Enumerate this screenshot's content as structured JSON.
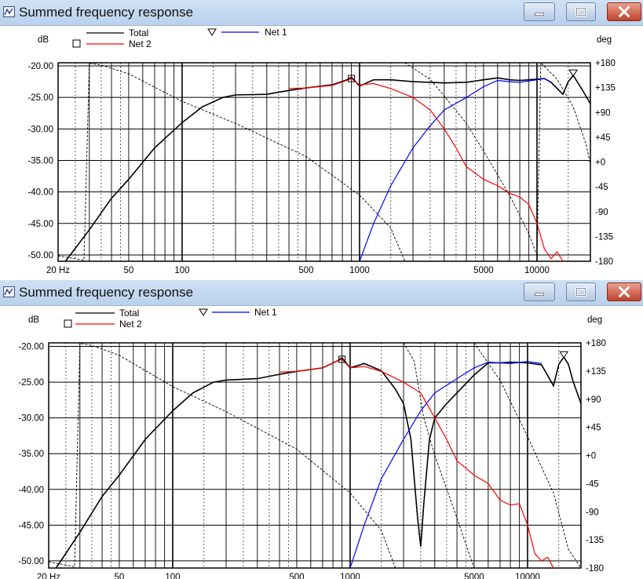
{
  "windows": [
    {
      "title": "Summed frequency response",
      "legend": {
        "total": "Total",
        "net1": "Net 1",
        "net2": "Net 2"
      },
      "units": {
        "left": "dB",
        "right": "deg"
      },
      "y_left_ticks": [
        "-20.00",
        "-25.00",
        "-30.00",
        "-35.00",
        "-40.00",
        "-45.00",
        "-50.00"
      ],
      "y_right_ticks": [
        "+180",
        "+135",
        "+90",
        "+45",
        "+0",
        "-45",
        "-90",
        "-135",
        "-180"
      ],
      "x_ticks": [
        "20 Hz",
        "50",
        "100",
        "500",
        "1000",
        "5000",
        "10000"
      ]
    },
    {
      "title": "Summed frequency response",
      "legend": {
        "total": "Total",
        "net1": "Net 1",
        "net2": "Net 2"
      },
      "units": {
        "left": "dB",
        "right": "deg"
      },
      "y_left_ticks": [
        "-20.00",
        "-25.00",
        "-30.00",
        "-35.00",
        "-40.00",
        "-45.00",
        "-50.00"
      ],
      "y_right_ticks": [
        "+180",
        "+135",
        "+90",
        "+45",
        "+0",
        "-45",
        "-90",
        "-135",
        "-180"
      ],
      "x_ticks": [
        "20 Hz",
        "50",
        "100",
        "500",
        "1000",
        "5000",
        "10000"
      ]
    }
  ],
  "colors": {
    "total": "#000000",
    "net1": "#0000ff",
    "net2": "#ff0000"
  },
  "icons": [
    "chart-app-icon",
    "minimize-icon",
    "maximize-icon",
    "close-icon",
    "triangle-marker-icon",
    "square-marker-icon"
  ],
  "chart_data": [
    {
      "type": "line",
      "x_scale": "log",
      "xlim": [
        20,
        20000
      ],
      "ylim": [
        -51,
        -19.5
      ],
      "y2lim": [
        -180,
        180
      ],
      "grid": true,
      "legend_position": "top",
      "series": [
        {
          "name": "Total",
          "axis": "left",
          "style": "solid",
          "points": [
            [
              22,
              -51
            ],
            [
              30,
              -46
            ],
            [
              40,
              -41
            ],
            [
              50,
              -38
            ],
            [
              70,
              -33
            ],
            [
              100,
              -29
            ],
            [
              130,
              -26.5
            ],
            [
              170,
              -25
            ],
            [
              200,
              -24.6
            ],
            [
              300,
              -24.5
            ],
            [
              400,
              -23.9
            ],
            [
              500,
              -23.5
            ],
            [
              700,
              -23.0
            ],
            [
              850,
              -22.2
            ],
            [
              900,
              -21.8
            ],
            [
              950,
              -22.5
            ],
            [
              1000,
              -23.2
            ],
            [
              1200,
              -22.2
            ],
            [
              1500,
              -22.2
            ],
            [
              2000,
              -22.5
            ],
            [
              3000,
              -22.7
            ],
            [
              4000,
              -22.6
            ],
            [
              5000,
              -22.2
            ],
            [
              6000,
              -21.9
            ],
            [
              7000,
              -22.2
            ],
            [
              8000,
              -22.3
            ],
            [
              10000,
              -22.1
            ],
            [
              11000,
              -22.0
            ],
            [
              12000,
              -22.6
            ],
            [
              14000,
              -24.5
            ],
            [
              15000,
              -22.5
            ],
            [
              16000,
              -21.5
            ],
            [
              18000,
              -23.8
            ],
            [
              20000,
              -26
            ]
          ]
        },
        {
          "name": "Net 1",
          "axis": "left",
          "style": "solid",
          "points": [
            [
              1000,
              -51
            ],
            [
              1200,
              -45
            ],
            [
              1500,
              -39
            ],
            [
              2000,
              -33
            ],
            [
              2500,
              -29.5
            ],
            [
              3000,
              -27
            ],
            [
              4000,
              -25
            ],
            [
              5000,
              -23.3
            ],
            [
              6000,
              -22.3
            ],
            [
              7000,
              -22.5
            ],
            [
              8000,
              -22.6
            ],
            [
              10000,
              -22.2
            ],
            [
              11000,
              -22.0
            ],
            [
              12000,
              -22.6
            ]
          ]
        },
        {
          "name": "Net 2",
          "axis": "left",
          "style": "solid",
          "points": [
            [
              400,
              -23.6
            ],
            [
              500,
              -23.5
            ],
            [
              700,
              -23.1
            ],
            [
              850,
              -22.3
            ],
            [
              900,
              -22.0
            ],
            [
              1000,
              -23.0
            ],
            [
              1200,
              -22.8
            ],
            [
              1500,
              -23.6
            ],
            [
              2000,
              -25
            ],
            [
              2500,
              -27
            ],
            [
              3000,
              -30
            ],
            [
              3500,
              -33
            ],
            [
              4000,
              -36
            ],
            [
              5000,
              -38
            ],
            [
              6000,
              -39
            ],
            [
              7000,
              -40.2
            ],
            [
              8000,
              -40.8
            ],
            [
              9000,
              -42
            ],
            [
              10000,
              -45
            ],
            [
              11000,
              -49
            ],
            [
              12000,
              -50.6
            ],
            [
              13000,
              -49.5
            ],
            [
              14000,
              -51
            ]
          ]
        },
        {
          "name": "",
          "axis": "right",
          "style": "dashed",
          "points": [
            [
              20,
              -170
            ],
            [
              28,
              -178
            ],
            [
              30,
              179
            ],
            [
              35,
              176
            ],
            [
              50,
              160
            ],
            [
              100,
              110
            ],
            [
              200,
              70
            ],
            [
              500,
              10
            ],
            [
              1000,
              -60
            ],
            [
              1500,
              -120
            ],
            [
              1800,
              -180
            ]
          ]
        },
        {
          "name": "",
          "axis": "right",
          "style": "dashed",
          "points": [
            [
              1800,
              180
            ],
            [
              2500,
              150
            ],
            [
              3000,
              120
            ],
            [
              4000,
              70
            ],
            [
              5000,
              20
            ],
            [
              7000,
              -60
            ],
            [
              9000,
              -130
            ],
            [
              10000,
              -170
            ],
            [
              10500,
              180
            ],
            [
              13000,
              150
            ],
            [
              16000,
              100
            ],
            [
              19000,
              30
            ],
            [
              20000,
              -5
            ]
          ]
        }
      ]
    },
    {
      "type": "line",
      "x_scale": "log",
      "xlim": [
        20,
        20000
      ],
      "ylim": [
        -51,
        -19.5
      ],
      "y2lim": [
        -180,
        180
      ],
      "grid": true,
      "legend_position": "top",
      "series": [
        {
          "name": "Total",
          "axis": "left",
          "style": "solid",
          "points": [
            [
              22,
              -51
            ],
            [
              30,
              -46
            ],
            [
              40,
              -41
            ],
            [
              50,
              -38
            ],
            [
              70,
              -33
            ],
            [
              100,
              -29
            ],
            [
              130,
              -26.5
            ],
            [
              170,
              -25
            ],
            [
              200,
              -24.7
            ],
            [
              300,
              -24.5
            ],
            [
              400,
              -23.9
            ],
            [
              500,
              -23.5
            ],
            [
              700,
              -23.0
            ],
            [
              850,
              -22.0
            ],
            [
              900,
              -21.6
            ],
            [
              1000,
              -23.0
            ],
            [
              1200,
              -22.4
            ],
            [
              1500,
              -23.4
            ],
            [
              1800,
              -26
            ],
            [
              2000,
              -28
            ],
            [
              2200,
              -33
            ],
            [
              2400,
              -44
            ],
            [
              2500,
              -48
            ],
            [
              2600,
              -42
            ],
            [
              2800,
              -33
            ],
            [
              3000,
              -30
            ],
            [
              3500,
              -28
            ],
            [
              4000,
              -26.5
            ],
            [
              5000,
              -24
            ],
            [
              6000,
              -22.3
            ],
            [
              7000,
              -22.3
            ],
            [
              8000,
              -22.2
            ],
            [
              10000,
              -22.3
            ],
            [
              12000,
              -22.6
            ],
            [
              14000,
              -25.5
            ],
            [
              15000,
              -22.5
            ],
            [
              16000,
              -21.5
            ],
            [
              17000,
              -22.5
            ],
            [
              18000,
              -24.8
            ],
            [
              20000,
              -28
            ]
          ]
        },
        {
          "name": "Net 1",
          "axis": "left",
          "style": "solid",
          "points": [
            [
              1000,
              -51
            ],
            [
              1200,
              -45
            ],
            [
              1500,
              -38.5
            ],
            [
              2000,
              -33
            ],
            [
              2500,
              -29
            ],
            [
              3000,
              -26.5
            ],
            [
              4000,
              -24.5
            ],
            [
              5000,
              -23
            ],
            [
              6000,
              -22.2
            ],
            [
              7000,
              -22.3
            ],
            [
              8000,
              -22.4
            ],
            [
              10000,
              -22.1
            ],
            [
              12000,
              -22.4
            ]
          ]
        },
        {
          "name": "Net 2",
          "axis": "left",
          "style": "solid",
          "points": [
            [
              400,
              -23.6
            ],
            [
              500,
              -23.5
            ],
            [
              700,
              -23.0
            ],
            [
              850,
              -22.0
            ],
            [
              900,
              -21.8
            ],
            [
              1000,
              -23.0
            ],
            [
              1200,
              -22.8
            ],
            [
              1500,
              -23.5
            ],
            [
              2000,
              -25
            ],
            [
              2500,
              -26.5
            ],
            [
              3000,
              -30
            ],
            [
              3500,
              -33
            ],
            [
              4000,
              -36
            ],
            [
              5000,
              -38
            ],
            [
              6000,
              -39.2
            ],
            [
              7000,
              -41.5
            ],
            [
              8000,
              -42.2
            ],
            [
              9000,
              -42
            ],
            [
              10000,
              -45
            ],
            [
              11000,
              -49
            ],
            [
              12000,
              -50
            ],
            [
              13000,
              -49.5
            ],
            [
              14000,
              -51
            ]
          ]
        },
        {
          "name": "",
          "axis": "right",
          "style": "dashed",
          "points": [
            [
              20,
              -170
            ],
            [
              28,
              -178
            ],
            [
              30,
              179
            ],
            [
              35,
              176
            ],
            [
              50,
              160
            ],
            [
              100,
              110
            ],
            [
              200,
              70
            ],
            [
              500,
              10
            ],
            [
              1000,
              -60
            ],
            [
              1500,
              -120
            ],
            [
              1800,
              -180
            ]
          ]
        },
        {
          "name": "",
          "axis": "right",
          "style": "dashed",
          "points": [
            [
              2000,
              180
            ],
            [
              2300,
              150
            ],
            [
              2600,
              60
            ],
            [
              3000,
              0
            ],
            [
              4000,
              -100
            ],
            [
              5000,
              -180
            ]
          ]
        },
        {
          "name": "",
          "axis": "right",
          "style": "dashed",
          "points": [
            [
              5000,
              180
            ],
            [
              7000,
              120
            ],
            [
              10000,
              30
            ],
            [
              14000,
              -60
            ],
            [
              17000,
              -150
            ],
            [
              20000,
              -180
            ]
          ]
        }
      ]
    }
  ]
}
